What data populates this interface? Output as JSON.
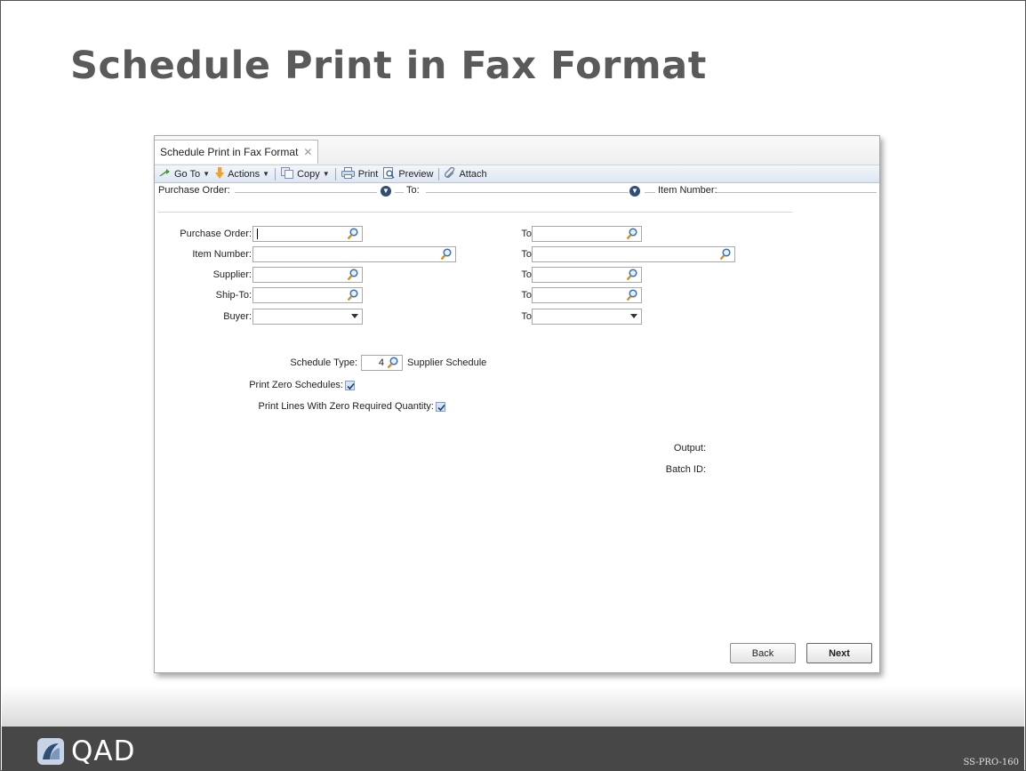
{
  "slide": {
    "title": "Schedule Print in Fax Format",
    "brand": "QAD",
    "code": "SS-PRO-160"
  },
  "tab": {
    "label": "Schedule Print in Fax Format",
    "close": "✕"
  },
  "toolbar": {
    "goto": "Go To",
    "actions": "Actions",
    "copy": "Copy",
    "print": "Print",
    "preview": "Preview",
    "attach": "Attach"
  },
  "filterbar": {
    "purchase_order": "Purchase Order:",
    "to": "To:",
    "item_number": "Item Number:"
  },
  "form": {
    "purchase_order": "Purchase Order:",
    "item_number": "Item Number:",
    "supplier": "Supplier:",
    "ship_to": "Ship-To:",
    "buyer": "Buyer:",
    "to": "To:",
    "schedule_type_label": "Schedule Type:",
    "schedule_type_value": "4",
    "schedule_type_desc": "Supplier Schedule",
    "print_zero_schedules": "Print Zero Schedules:",
    "print_zero_schedules_checked": true,
    "print_lines_zero_qty": "Print Lines With Zero Required Quantity:",
    "print_lines_zero_qty_checked": true,
    "output": "Output:",
    "batch_id": "Batch ID:"
  },
  "buttons": {
    "back": "Back",
    "next": "Next"
  },
  "colors": {
    "title": "#5a5a5a",
    "footer": "#474747",
    "accent": "#2f4d75"
  }
}
